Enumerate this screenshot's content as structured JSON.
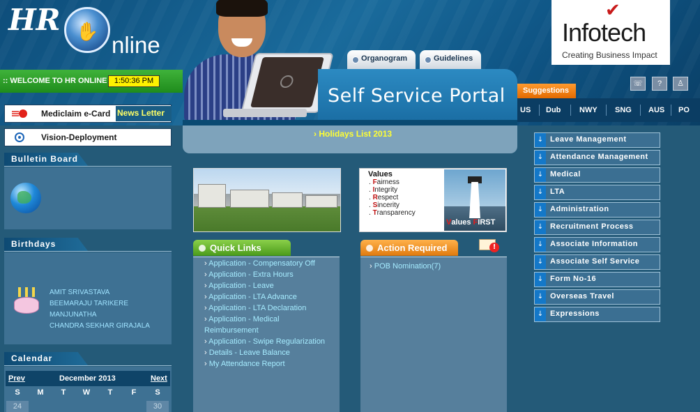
{
  "header": {
    "logo_hr": "HR",
    "logo_online": "nline",
    "welcome": ":: WELCOME TO HR ONLINE",
    "clock": "1:50:36 PM",
    "tabs": [
      {
        "label": "Organogram"
      },
      {
        "label": "Guidelines"
      }
    ],
    "portal_title": "Self Service Portal",
    "company": "Infotech",
    "tagline": "Creating Business Impact",
    "suggestions": "Suggestions",
    "cities": [
      "US",
      "Dub",
      "NWY",
      "SNG",
      "AUS",
      "PO"
    ],
    "util_icons": [
      "phone-icon",
      "help-icon",
      "user-icon"
    ],
    "help_glyph": "?"
  },
  "holidays": "Holidays List 2013",
  "left": {
    "mediclaim": "Mediclaim e-Card",
    "newsletter": "News Letter",
    "vision": "Vision-Deployment",
    "bulletin_title": "Bulletin Board",
    "birthdays_title": "Birthdays",
    "birthdays": [
      "AMIT SRIVASTAVA",
      "BEEMARAJU TARIKERE",
      "MANJUNATHA",
      "CHANDRA SEKHAR GIRAJALA"
    ],
    "calendar_title": "Calendar",
    "calendar": {
      "prev": "Prev",
      "next": "Next",
      "month": "December 2013",
      "days_of_week": [
        "S",
        "M",
        "T",
        "W",
        "T",
        "F",
        "S"
      ],
      "first_row": [
        "24",
        "30"
      ]
    }
  },
  "values": {
    "title": "Values",
    "items": [
      {
        "initial": "F",
        "rest": "airness"
      },
      {
        "initial": "I",
        "rest": "ntegrity"
      },
      {
        "initial": "R",
        "rest": "espect"
      },
      {
        "initial": "S",
        "rest": "incerity"
      },
      {
        "initial": "T",
        "rest": "ransparency"
      }
    ],
    "badge_values": "alues ",
    "badge_v": "V",
    "badge_f": "F",
    "badge_irst": "IRST"
  },
  "quick_links": {
    "title": "Quick Links",
    "items": [
      "Application - Compensatory Off",
      "Application - Extra Hours",
      "Application - Leave",
      "Application - LTA Advance",
      "Application - LTA Declaration",
      "Application - Medical",
      "Reimbursement",
      "Application - Swipe Regularization",
      "Details - Leave Balance",
      "My Attendance Report"
    ]
  },
  "action_required": {
    "title": "Action Required",
    "items": [
      "POB Nomination(7)"
    ]
  },
  "right_menu": [
    "Leave Management",
    "Attendance Management",
    "Medical",
    "LTA",
    "Administration",
    "Recruitment Process",
    "Associate Information",
    "Associate Self Service",
    "Form No-16",
    "Overseas Travel",
    "Expressions"
  ],
  "colors": {
    "page_bg": "#245a78",
    "welcome_green": "#3fb23a",
    "clock_yellow": "#fff200",
    "holiday_text": "#ffff33",
    "link_cyan": "#a6ecff",
    "suggestions_orange": "#ff9a2e",
    "infotech_red": "#c81a1a"
  }
}
